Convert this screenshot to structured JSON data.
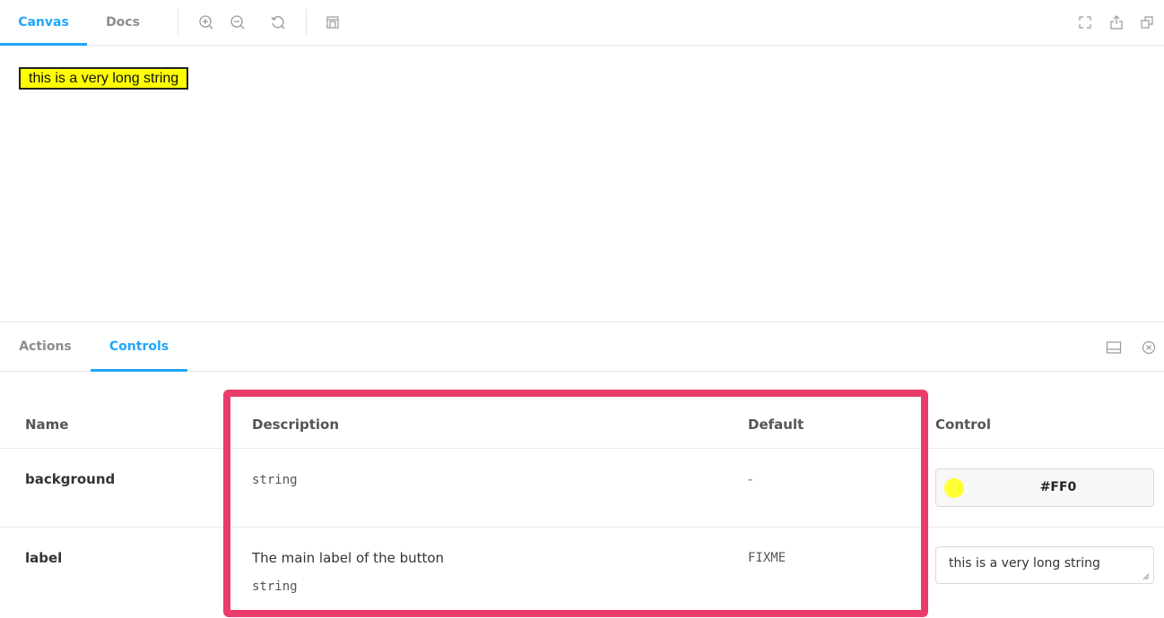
{
  "toolbar": {
    "tabs": [
      {
        "label": "Canvas",
        "active": true
      },
      {
        "label": "Docs",
        "active": false
      }
    ],
    "icons": [
      "zoom-in-icon",
      "zoom-out-icon",
      "reset-zoom-icon",
      "background-grid-icon",
      "fullscreen-icon",
      "share-icon",
      "copy-link-icon"
    ]
  },
  "preview": {
    "button_label": "this is a very long string",
    "button_bg": "#ffff00"
  },
  "panel": {
    "tabs": [
      {
        "label": "Actions",
        "active": false
      },
      {
        "label": "Controls",
        "active": true
      }
    ],
    "icons": [
      "panel-orientation-icon",
      "close-panel-icon"
    ]
  },
  "table": {
    "headers": {
      "name": "Name",
      "description": "Description",
      "default": "Default",
      "control": "Control"
    },
    "rows": [
      {
        "name": "background",
        "description": "",
        "type": "string",
        "default": "-",
        "control_value": "#FF0",
        "swatch_color": "#ffff33"
      },
      {
        "name": "label",
        "description": "The main label of the button",
        "type": "string",
        "default": "FIXME",
        "control_value": "this is a very long string"
      }
    ]
  },
  "colors": {
    "accent": "#1ea7fd",
    "highlight_border": "#ea3c6b"
  }
}
